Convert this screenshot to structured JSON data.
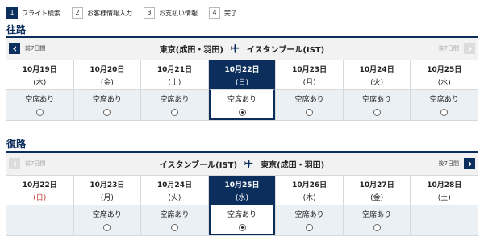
{
  "steps": [
    {
      "num": "1",
      "label": "フライト検索"
    },
    {
      "num": "2",
      "label": "お客様情報入力"
    },
    {
      "num": "3",
      "label": "お支払い情報"
    },
    {
      "num": "4",
      "label": "完了"
    }
  ],
  "outbound": {
    "title": "往路",
    "origin": "東京(成田・羽田)",
    "destination": "イスタンブール(IST)",
    "prev_label": "前7日間",
    "next_label": "後7日間",
    "days": [
      {
        "date": "10月19日",
        "dow": "(木)",
        "avail": "空席あり"
      },
      {
        "date": "10月20日",
        "dow": "(金)",
        "avail": "空席あり"
      },
      {
        "date": "10月21日",
        "dow": "(土)",
        "avail": "空席あり"
      },
      {
        "date": "10月22日",
        "dow": "(日)",
        "avail": "空席あり"
      },
      {
        "date": "10月23日",
        "dow": "(月)",
        "avail": "空席あり"
      },
      {
        "date": "10月24日",
        "dow": "(火)",
        "avail": "空席あり"
      },
      {
        "date": "10月25日",
        "dow": "(水)",
        "avail": "空席あり"
      }
    ]
  },
  "return": {
    "title": "復路",
    "origin": "イスタンブール(IST)",
    "destination": "東京(成田・羽田)",
    "prev_label": "前7日間",
    "next_label": "後7日間",
    "days": [
      {
        "date": "10月22日",
        "dow": "(日)",
        "avail": ""
      },
      {
        "date": "10月23日",
        "dow": "(月)",
        "avail": "空席あり"
      },
      {
        "date": "10月24日",
        "dow": "(火)",
        "avail": "空席あり"
      },
      {
        "date": "10月25日",
        "dow": "(水)",
        "avail": "空席あり"
      },
      {
        "date": "10月26日",
        "dow": "(木)",
        "avail": "空席あり"
      },
      {
        "date": "10月27日",
        "dow": "(金)",
        "avail": "空席あり"
      },
      {
        "date": "10月28日",
        "dow": "(土)",
        "avail": ""
      }
    ]
  },
  "colors": {
    "accent": "#0c2e5c",
    "holiday": "#c0392b"
  }
}
